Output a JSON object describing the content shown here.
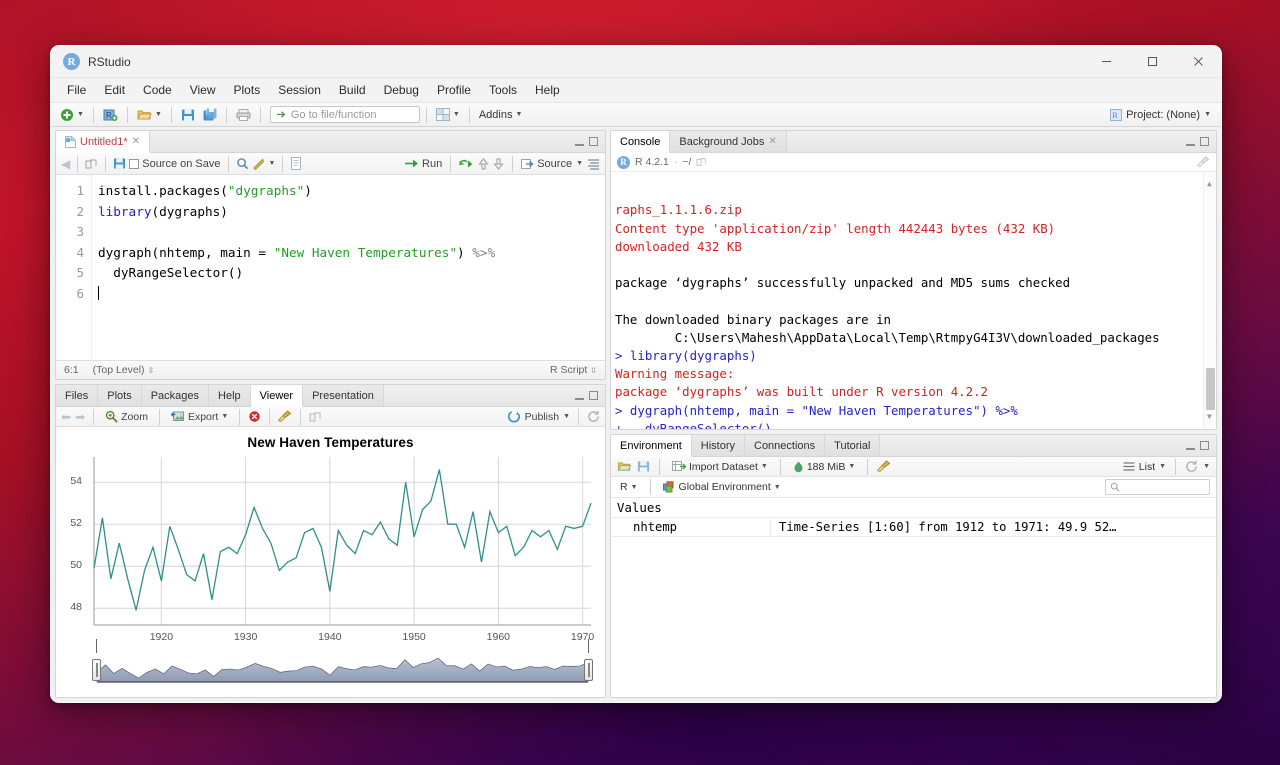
{
  "window": {
    "title": "RStudio",
    "logo_letter": "R",
    "controls": {
      "minimize": "—",
      "maximize": "□",
      "close": "✕"
    }
  },
  "menubar": {
    "items": [
      "File",
      "Edit",
      "Code",
      "View",
      "Plots",
      "Session",
      "Build",
      "Debug",
      "Profile",
      "Tools",
      "Help"
    ]
  },
  "toolbar": {
    "new_file_icon": "new-file-icon",
    "new_project_icon": "new-project-icon",
    "open_icon": "open-folder-icon",
    "save_icon": "save-icon",
    "save_all_icon": "save-all-icon",
    "print_icon": "print-icon",
    "goto_placeholder": "Go to file/function",
    "grid_icon": "workspace-panes-icon",
    "addins_label": "Addins",
    "project_label": "Project: (None)"
  },
  "source_pane": {
    "tab_label": "Untitled1*",
    "tab_close": "✕",
    "toolbar": {
      "back_icon": "back-arrow-icon",
      "forward_icon": "forward-arrow-icon",
      "show_doc_outline_icon": "popout-icon",
      "save_icon": "save-icon",
      "source_on_save_label": "Source on Save",
      "find_icon": "search-icon",
      "magic_icon": "code-tools-icon",
      "compile_icon": "compile-report-icon",
      "run_label": "Run",
      "rerun_icon": "rerun-icon",
      "prev_chunk_icon": "up-arrow-icon",
      "next_chunk_icon": "down-arrow-icon",
      "source_label": "Source",
      "outline_icon": "document-outline-icon"
    },
    "line_numbers": [
      "1",
      "2",
      "3",
      "4",
      "5",
      "6"
    ],
    "code_lines": [
      [
        {
          "t": "install.packages(",
          "c": "fn"
        },
        {
          "t": "\"dygraphs\"",
          "c": "str"
        },
        {
          "t": ")",
          "c": "fn"
        }
      ],
      [
        {
          "t": "library",
          "c": "kw"
        },
        {
          "t": "(dygraphs)",
          "c": "fn"
        }
      ],
      [],
      [
        {
          "t": "dygraph(nhtemp, main = ",
          "c": "fn"
        },
        {
          "t": "\"New Haven Temperatures\"",
          "c": "str"
        },
        {
          "t": ") ",
          "c": "fn"
        },
        {
          "t": "%>%",
          "c": "op"
        }
      ],
      [
        {
          "t": "  dyRangeSelector()",
          "c": "fn"
        }
      ],
      []
    ],
    "status": {
      "cursor": "6:1",
      "scope": "(Top Level)",
      "filetype": "R Script"
    }
  },
  "viewer_pane": {
    "tabs": [
      "Files",
      "Plots",
      "Packages",
      "Help",
      "Viewer",
      "Presentation"
    ],
    "active_tab": "Viewer",
    "toolbar": {
      "back_icon": "back-arrow-icon",
      "forward_icon": "forward-arrow-icon",
      "zoom_label": "Zoom",
      "zoom_icon": "magnifier-icon",
      "export_label": "Export",
      "export_icon": "export-image-icon",
      "remove_icon": "remove-plot-icon",
      "clear_icon": "broom-icon",
      "popout_icon": "popout-icon",
      "publish_label": "Publish",
      "publish_icon": "publish-icon",
      "refresh_icon": "refresh-icon"
    }
  },
  "console_pane": {
    "tabs": [
      "Console",
      "Background Jobs"
    ],
    "active_tab": "Console",
    "r_version": "R 4.2.1",
    "working_dir": "~/",
    "popout_icon": "popout-icon",
    "clear_icon": "broom-icon",
    "output": [
      {
        "text": "raphs_1.1.1.6.zip",
        "color": "red",
        "clipped_top": true
      },
      {
        "text": "Content type 'application/zip' length 442443 bytes (432 KB)",
        "color": "red"
      },
      {
        "text": "downloaded 432 KB",
        "color": "red"
      },
      {
        "text": "",
        "color": "black"
      },
      {
        "text": "package ‘dygraphs’ successfully unpacked and MD5 sums checked",
        "color": "black"
      },
      {
        "text": "",
        "color": "black"
      },
      {
        "text": "The downloaded binary packages are in",
        "color": "black"
      },
      {
        "text": "        C:\\Users\\Mahesh\\AppData\\Local\\Temp\\RtmpyG4I3V\\downloaded_packages",
        "color": "black"
      },
      {
        "text": "> library(dygraphs)",
        "color": "blue"
      },
      {
        "text": "Warning message:",
        "color": "red"
      },
      {
        "text": "package ‘dygraphs’ was built under R version 4.2.2",
        "color": "red"
      },
      {
        "text": "> dygraph(nhtemp, main = \"New Haven Temperatures\") %>%",
        "color": "blue"
      },
      {
        "text": "+   dyRangeSelector()",
        "color": "blue"
      },
      {
        "text": "> ",
        "color": "blue"
      }
    ]
  },
  "environment_pane": {
    "tabs": [
      "Environment",
      "History",
      "Connections",
      "Tutorial"
    ],
    "active_tab": "Environment",
    "toolbar": {
      "load_icon": "open-folder-icon",
      "save_icon": "save-icon",
      "import_label": "Import Dataset",
      "import_icon": "import-dataset-icon",
      "memory_label": "188 MiB",
      "memory_icon": "memory-icon",
      "clear_icon": "broom-icon",
      "view_mode_label": "List",
      "view_mode_icon": "list-icon",
      "refresh_icon": "refresh-icon"
    },
    "toolbar2": {
      "language_label": "R",
      "scope_label": "Global Environment",
      "scope_icon": "cube-icon",
      "search_placeholder": "",
      "search_icon": "search-icon"
    },
    "section_title": "Values",
    "rows": [
      {
        "name": "nhtemp",
        "value": "Time-Series [1:60] from 1912 to 1971: 49.9 52…"
      }
    ]
  },
  "colors": {
    "accent_blue": "#75aadb",
    "chart_line": "#2f8f8a",
    "console_red": "#d42222",
    "console_blue": "#2424c8",
    "string_green": "#22a022",
    "keyword_blue": "#2020d0"
  },
  "chart_data": {
    "type": "line",
    "title": "New Haven Temperatures",
    "xlabel": "",
    "ylabel": "",
    "xlim": [
      1912,
      1971
    ],
    "ylim": [
      47.2,
      55.2
    ],
    "grid": true,
    "legend": "none",
    "xticks": [
      1920,
      1930,
      1940,
      1950,
      1960,
      1970
    ],
    "yticks": [
      48,
      50,
      52,
      54
    ],
    "series": [
      {
        "name": "nhtemp",
        "x": [
          1912,
          1913,
          1914,
          1915,
          1916,
          1917,
          1918,
          1919,
          1920,
          1921,
          1922,
          1923,
          1924,
          1925,
          1926,
          1927,
          1928,
          1929,
          1930,
          1931,
          1932,
          1933,
          1934,
          1935,
          1936,
          1937,
          1938,
          1939,
          1940,
          1941,
          1942,
          1943,
          1944,
          1945,
          1946,
          1947,
          1948,
          1949,
          1950,
          1951,
          1952,
          1953,
          1954,
          1955,
          1956,
          1957,
          1958,
          1959,
          1960,
          1961,
          1962,
          1963,
          1964,
          1965,
          1966,
          1967,
          1968,
          1969,
          1970,
          1971
        ],
        "values": [
          49.9,
          52.3,
          49.4,
          51.1,
          49.4,
          47.9,
          49.8,
          50.9,
          49.3,
          51.9,
          50.8,
          49.6,
          49.3,
          50.6,
          48.4,
          50.7,
          50.9,
          50.6,
          51.5,
          52.8,
          51.8,
          51.1,
          49.8,
          50.2,
          50.4,
          51.6,
          51.8,
          50.9,
          48.8,
          51.7,
          51.0,
          50.6,
          51.7,
          51.5,
          52.1,
          51.3,
          51.0,
          54.0,
          51.4,
          52.7,
          53.1,
          54.6,
          52.0,
          52.0,
          50.9,
          52.6,
          50.2,
          52.6,
          51.6,
          51.9,
          50.5,
          50.9,
          51.7,
          51.4,
          51.7,
          50.8,
          51.9,
          51.8,
          51.9,
          53.0
        ],
        "color": "#2f8f8a"
      }
    ],
    "range_selector": {
      "enabled": true,
      "fill_top": "#b9c3d4",
      "fill_bottom": "#8d9ab2",
      "handle_left_x": 1912,
      "handle_right_x": 1971
    }
  }
}
